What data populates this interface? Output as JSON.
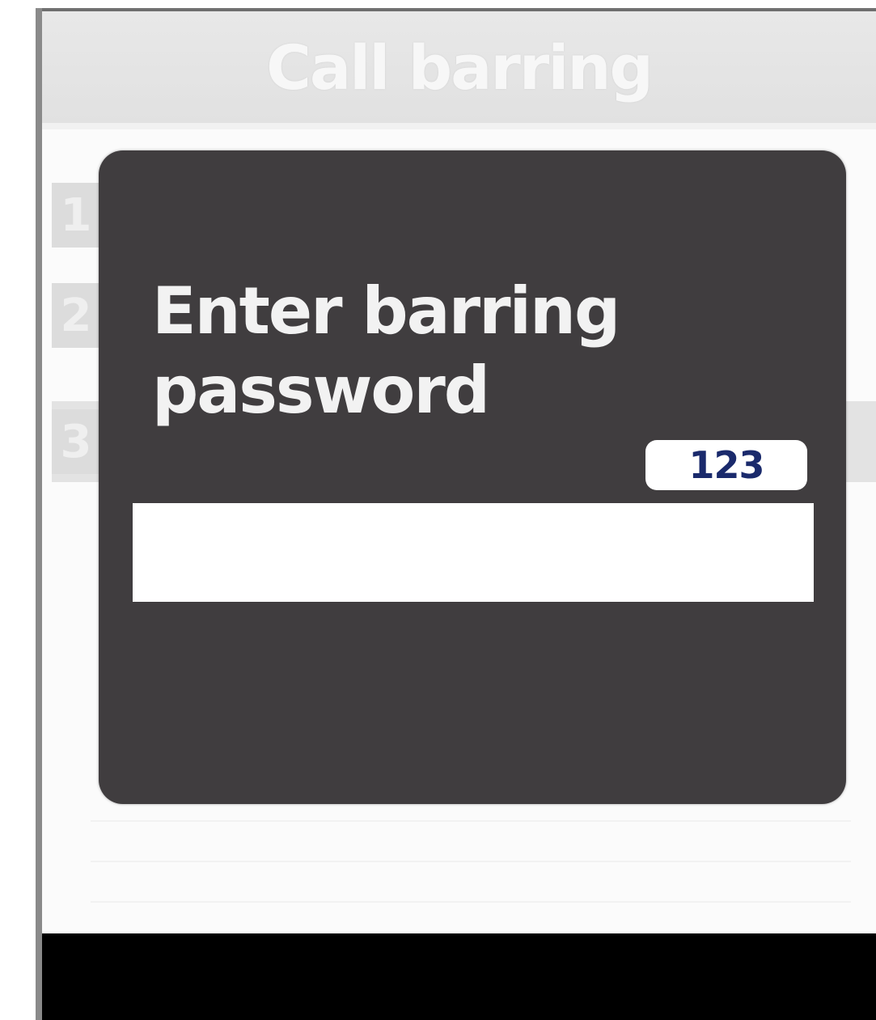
{
  "screen": {
    "title": "Call barring"
  },
  "menu": {
    "items": [
      {
        "number": "1"
      },
      {
        "number": "2"
      },
      {
        "number": "3"
      }
    ]
  },
  "dialog": {
    "prompt": "Enter barring password",
    "input_mode": "123",
    "password_value": ""
  },
  "colors": {
    "dialog_background": "#403d3f",
    "title_bar": "#e3e3e3",
    "input_mode_text": "#1a2a6c",
    "softkey_bar": "#000000"
  }
}
